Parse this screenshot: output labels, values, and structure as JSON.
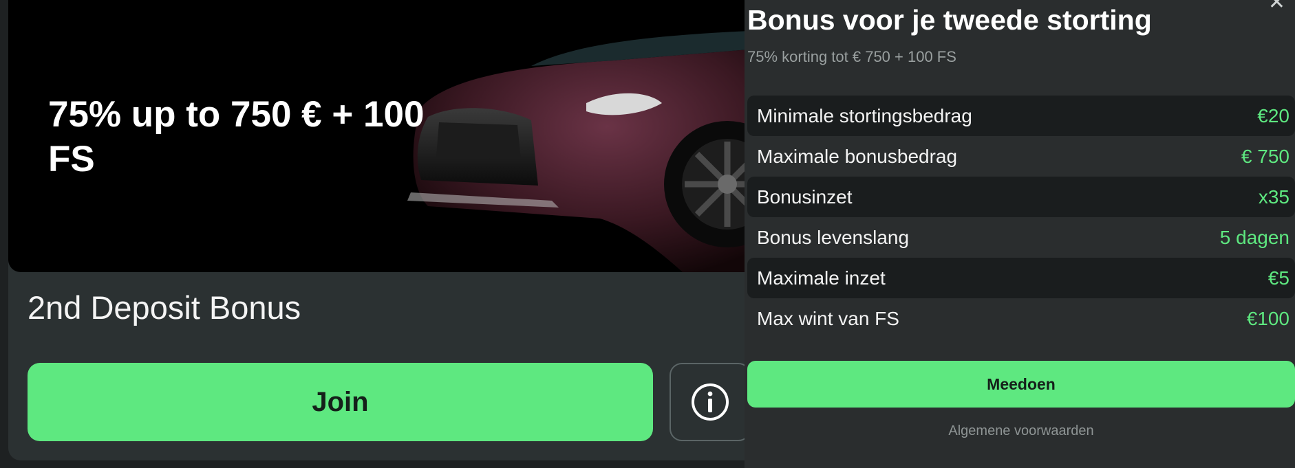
{
  "card": {
    "hero_title": "75% up to 750 € + 100 FS",
    "title": "2nd Deposit Bonus",
    "join_label": "Join",
    "info_icon": "info-icon"
  },
  "panel": {
    "close_icon": "close-icon",
    "title": "Bonus voor je tweede storting",
    "subtitle": "75% korting tot € 750 + 100 FS",
    "rows": [
      {
        "label": "Minimale stortingsbedrag",
        "value": "€20"
      },
      {
        "label": "Maximale bonusbedrag",
        "value": "€ 750"
      },
      {
        "label": "Bonusinzet",
        "value": "x35"
      },
      {
        "label": "Bonus levenslang",
        "value": "5 dagen"
      },
      {
        "label": "Maximale inzet",
        "value": "€5"
      },
      {
        "label": "Max wint van FS",
        "value": "€100"
      }
    ],
    "cta_label": "Meedoen",
    "terms_link": "Algemene voorwaarden"
  },
  "colors": {
    "accent": "#5ee880",
    "panel_bg": "#2a2d2e",
    "card_bg": "#2b3132"
  }
}
